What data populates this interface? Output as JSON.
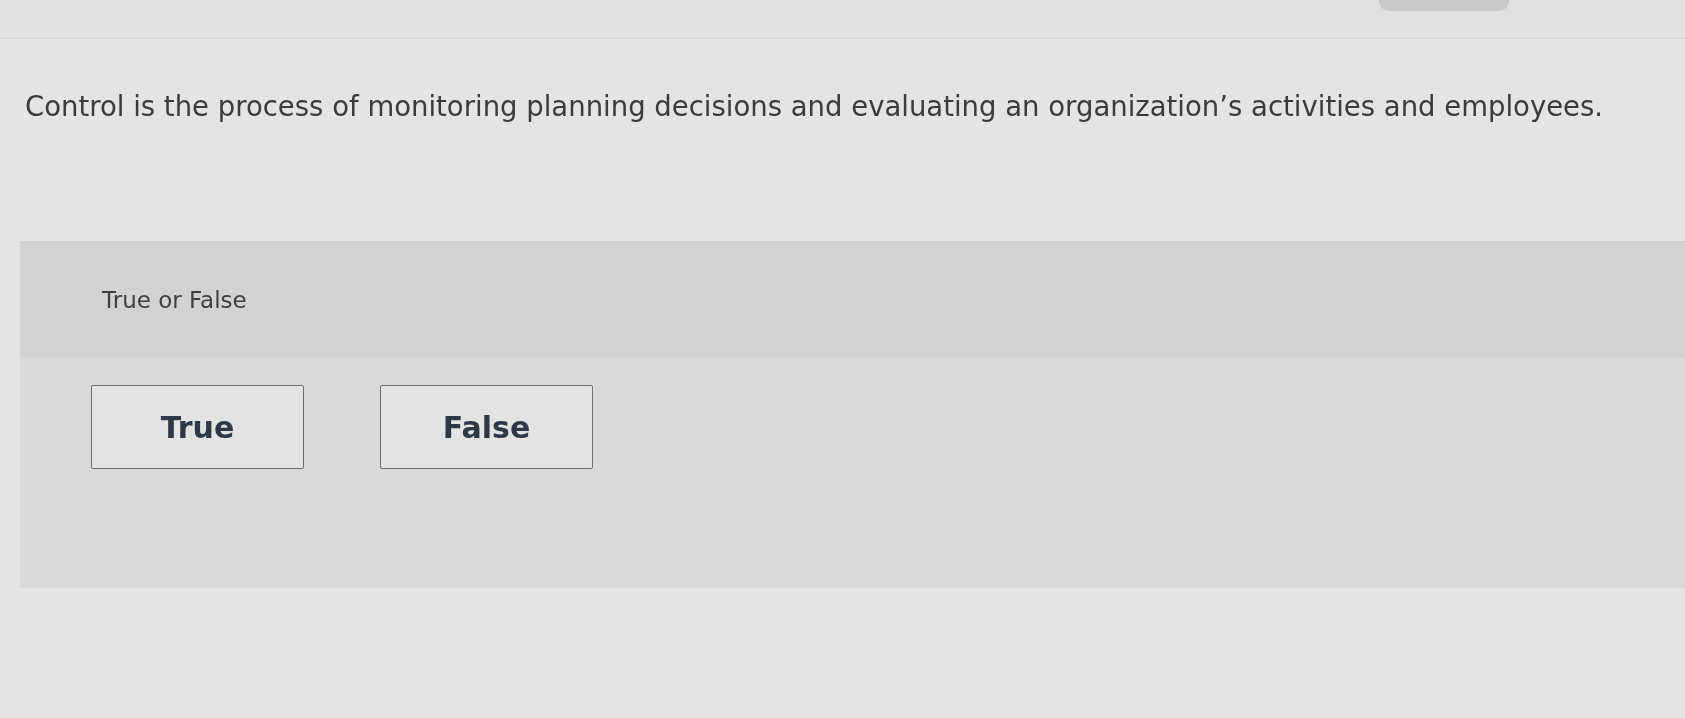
{
  "question": {
    "text": "Control is the process of monitoring planning decisions and evaluating an organization’s activities and employees."
  },
  "answer_panel": {
    "prompt": "True or False",
    "options": [
      {
        "label": "True",
        "selected": false
      },
      {
        "label": "False",
        "selected": false
      }
    ]
  }
}
